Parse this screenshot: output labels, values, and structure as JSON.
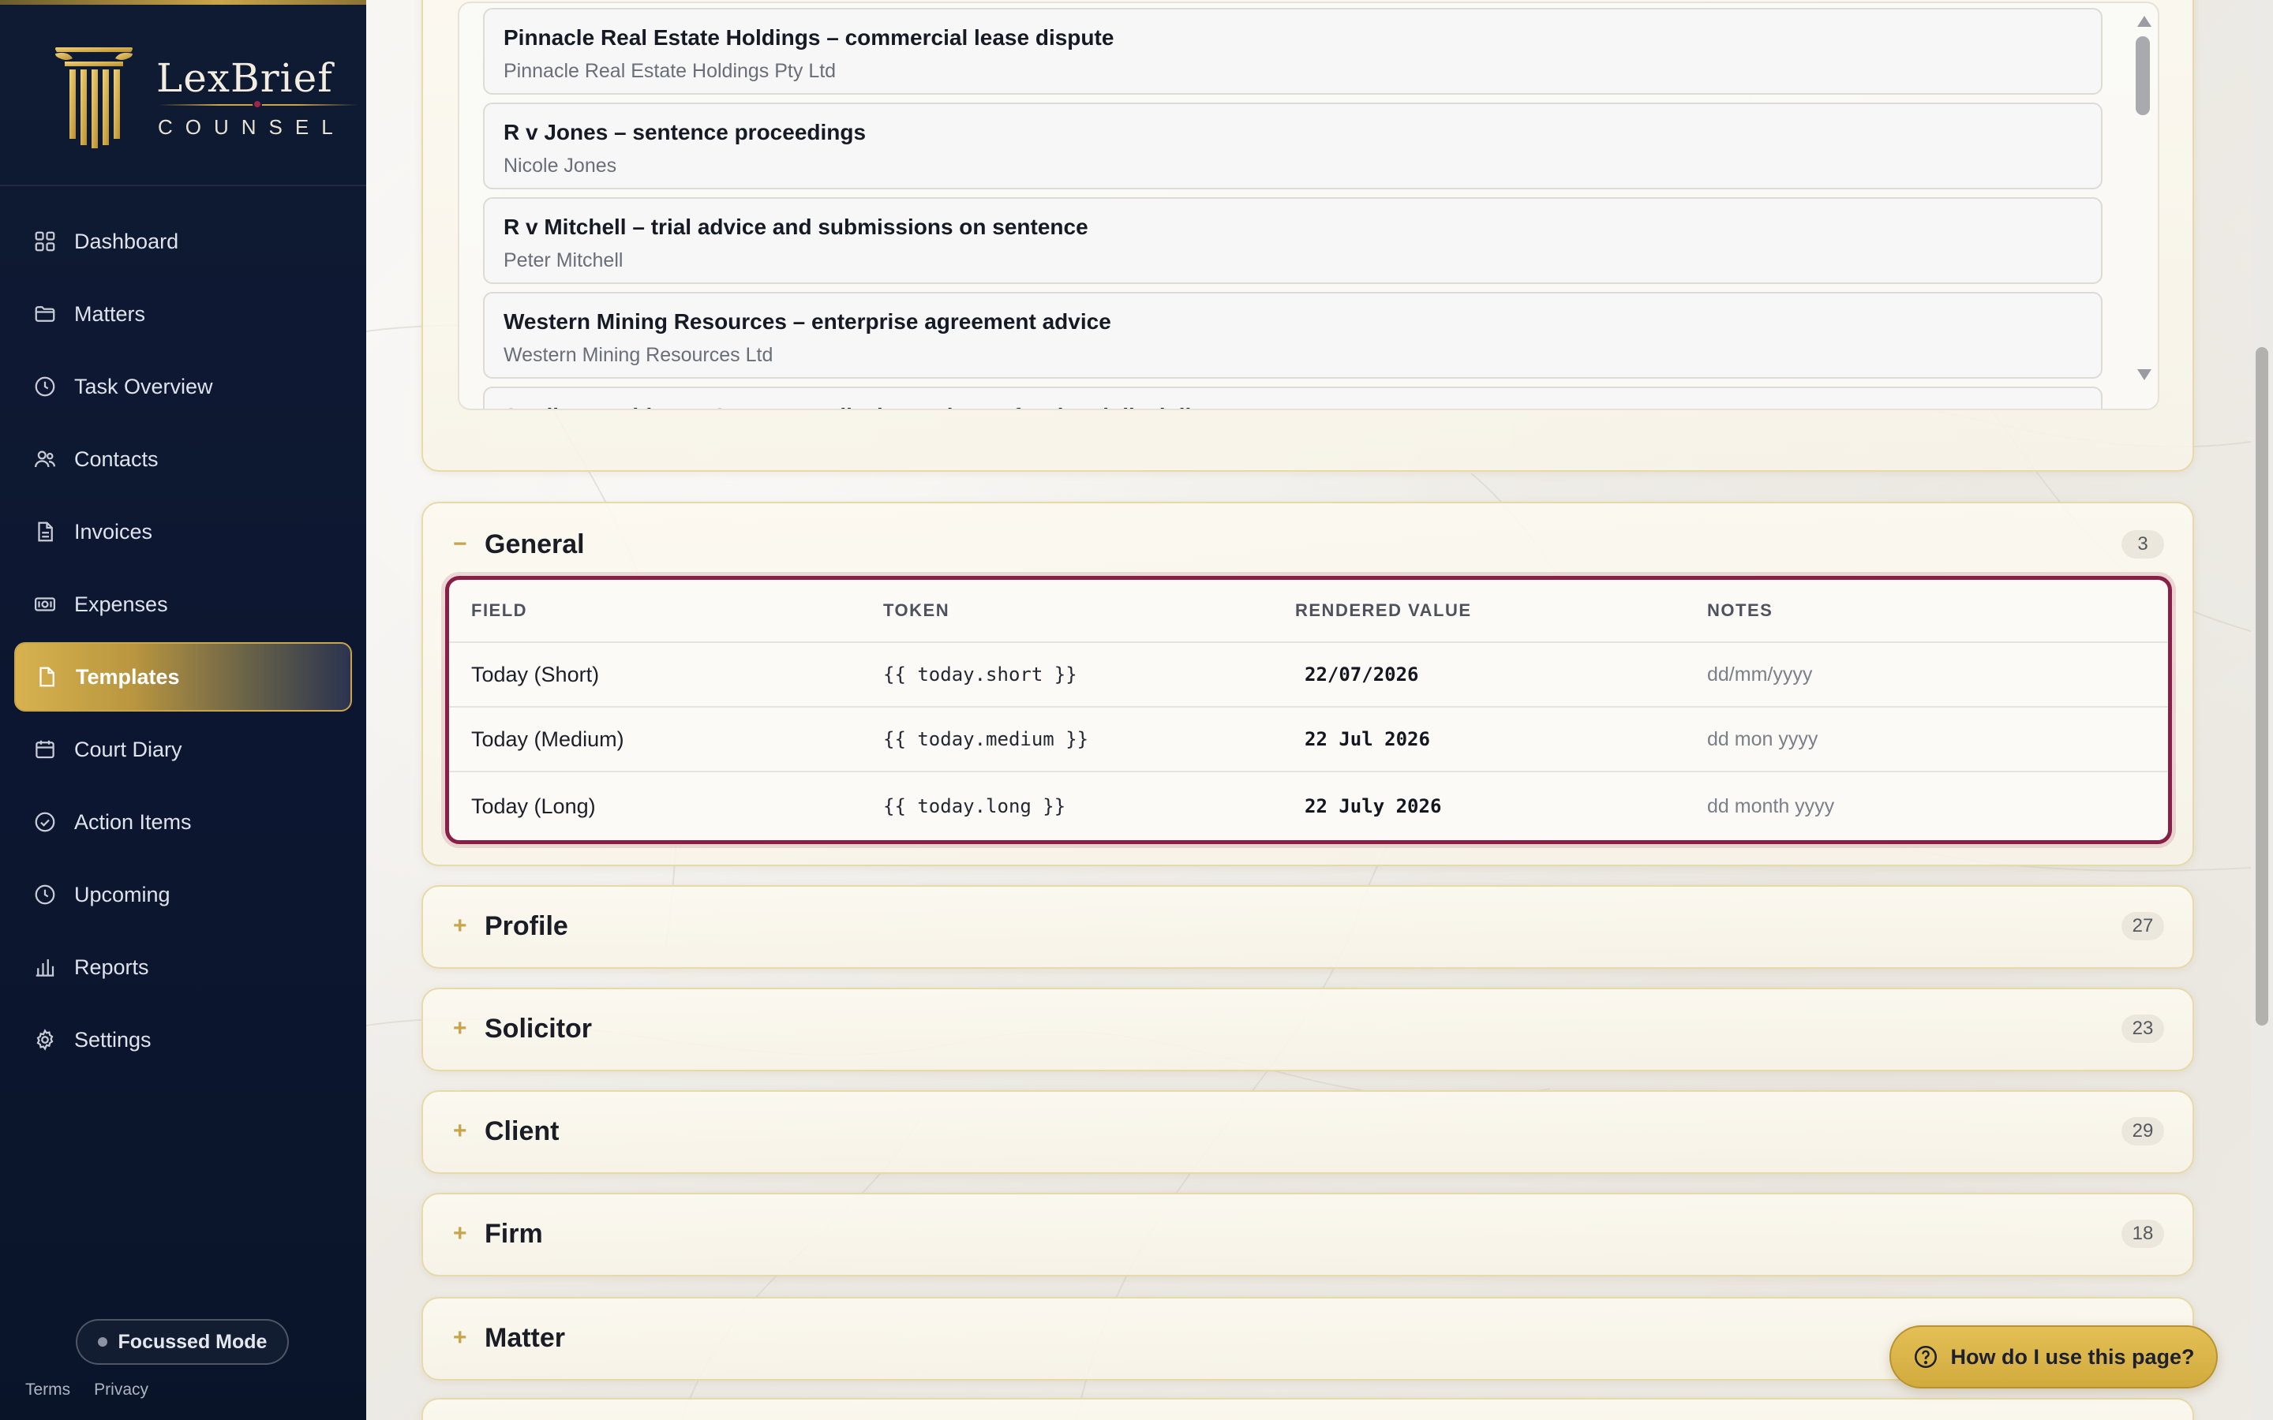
{
  "brand": {
    "name": "LexBrief",
    "subtitle": "COUNSEL"
  },
  "nav": [
    {
      "label": "Dashboard",
      "icon": "grid-icon"
    },
    {
      "label": "Matters",
      "icon": "folder-icon"
    },
    {
      "label": "Task Overview",
      "icon": "clock-icon"
    },
    {
      "label": "Contacts",
      "icon": "users-icon"
    },
    {
      "label": "Invoices",
      "icon": "document-icon"
    },
    {
      "label": "Expenses",
      "icon": "banknote-icon"
    },
    {
      "label": "Templates",
      "icon": "file-icon",
      "active": true
    },
    {
      "label": "Court Diary",
      "icon": "calendar-icon"
    },
    {
      "label": "Action Items",
      "icon": "check-circle-icon"
    },
    {
      "label": "Upcoming",
      "icon": "clock-icon"
    },
    {
      "label": "Reports",
      "icon": "bar-chart-icon"
    },
    {
      "label": "Settings",
      "icon": "gear-icon"
    }
  ],
  "focus_mode": {
    "label": "Focussed Mode"
  },
  "legal": {
    "terms": "Terms",
    "privacy": "Privacy"
  },
  "matters": [
    {
      "title": "Pinnacle Real Estate Holdings – commercial lease dispute",
      "client": "Pinnacle Real Estate Holdings Pty Ltd"
    },
    {
      "title": "R v Jones – sentence proceedings",
      "client": "Nicole Jones"
    },
    {
      "title": "R v Mitchell – trial advice and submissions on sentence",
      "client": "Peter Mitchell"
    },
    {
      "title": "Western Mining Resources – enterprise agreement advice",
      "client": "Western Mining Resources Ltd"
    },
    {
      "title": "Sterling Healthcare Group v Medical Board – professional discipline",
      "client": ""
    }
  ],
  "general": {
    "title": "General",
    "toggle": "−",
    "count": "3",
    "columns": {
      "field": "FIELD",
      "token": "TOKEN",
      "rendered": "RENDERED VALUE",
      "notes": "NOTES"
    },
    "rows": [
      {
        "field": "Today (Short)",
        "token": "{{ today.short }}",
        "value": "22/07/2026",
        "notes": "dd/mm/yyyy"
      },
      {
        "field": "Today (Medium)",
        "token": "{{ today.medium }}",
        "value": "22 Jul 2026",
        "notes": "dd mon yyyy"
      },
      {
        "field": "Today (Long)",
        "token": "{{ today.long }}",
        "value": "22 July 2026",
        "notes": "dd month yyyy"
      }
    ]
  },
  "sections": [
    {
      "title": "Profile",
      "toggle": "+",
      "count": "27"
    },
    {
      "title": "Solicitor",
      "toggle": "+",
      "count": "23"
    },
    {
      "title": "Client",
      "toggle": "+",
      "count": "29"
    },
    {
      "title": "Firm",
      "toggle": "+",
      "count": "18"
    },
    {
      "title": "Matter",
      "toggle": "+",
      "count": ""
    }
  ],
  "help": {
    "label": "How do I use this page?"
  },
  "colors": {
    "navy": "#0f1a33",
    "gold": "#c9a54a",
    "burgundy": "#8a1f46"
  }
}
